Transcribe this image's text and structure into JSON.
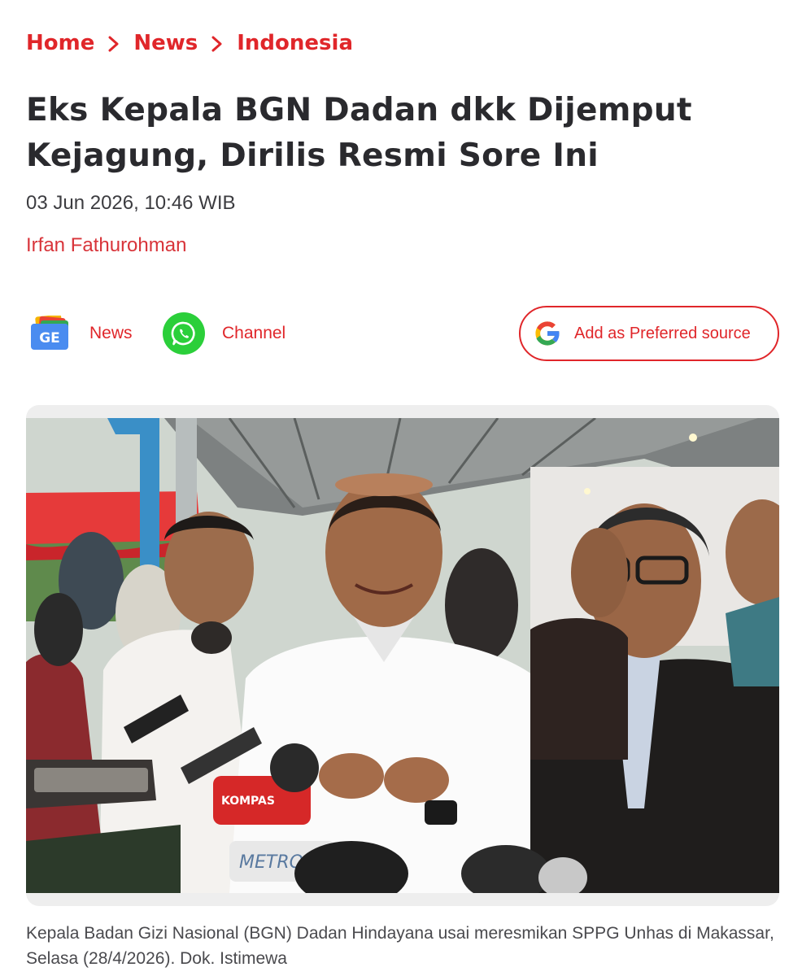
{
  "breadcrumb": {
    "items": [
      "Home",
      "News",
      "Indonesia"
    ]
  },
  "article": {
    "title": "Eks Kepala BGN Dadan dkk Dijemput Kejagung, Dirilis Resmi Sore Ini",
    "date": "03 Jun 2026, 10:46 WIB",
    "author": "Irfan Fathurohman"
  },
  "share": {
    "google_news_label": "News",
    "whatsapp_label": "Channel",
    "preferred_source_label": "Add as Preferred source",
    "google_news_icon_text": "GE"
  },
  "media": {
    "photo_text_kompas": "KOMPAS",
    "photo_text_metro": "METRO",
    "caption": "Kepala Badan Gizi Nasional (BGN) Dadan Hindayana usai meresmikan SPPG Unhas di Makassar, Selasa (28/4/2026). Dok. Istimewa"
  },
  "colors": {
    "accent": "#e0262a",
    "title": "#2a2a2e",
    "whatsapp": "#2bcf3a"
  }
}
